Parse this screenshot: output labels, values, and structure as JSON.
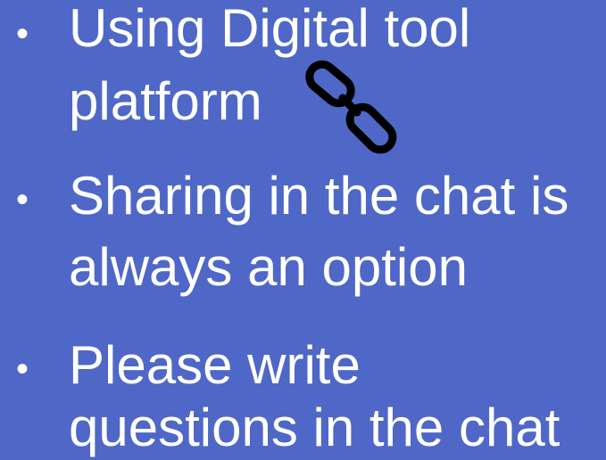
{
  "slide": {
    "bullets": [
      {
        "marker": "•",
        "lines": [
          "Using Digital tool",
          "platform"
        ]
      },
      {
        "marker": "•",
        "lines": [
          "Sharing in the chat is",
          "always an option"
        ]
      },
      {
        "marker": "•",
        "lines": [
          "Please write",
          "questions in the chat"
        ]
      }
    ],
    "link_icon": "chain-link-icon",
    "colors": {
      "background": "#4f67c7",
      "text": "#ffffff",
      "icon": "#000000"
    }
  }
}
